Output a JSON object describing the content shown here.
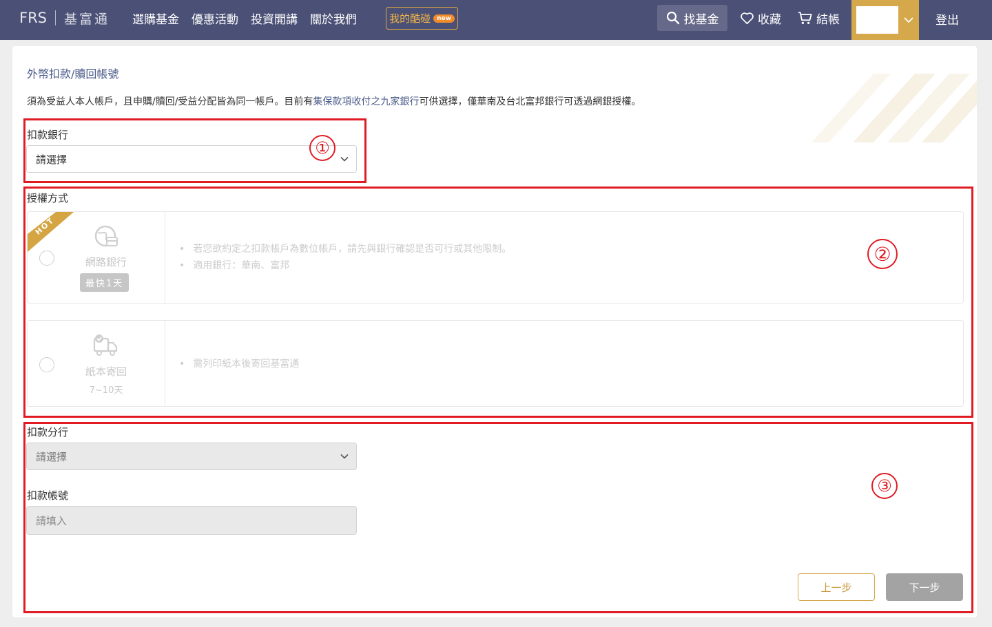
{
  "header": {
    "logo_text": "FRS",
    "company_name": "基富通",
    "nav": [
      "選購基金",
      "優惠活動",
      "投資開講",
      "關於我們"
    ],
    "my_coupon": "我的酷碰",
    "new_badge": "new",
    "find_fund": "找基金",
    "favorite": "收藏",
    "checkout": "結帳",
    "logout": "登出"
  },
  "page": {
    "section_title": "外幣扣款/贖回帳號",
    "notice_before": "須為受益人本人帳戶，且申購/贖回/受益分配皆為同一帳戶。目前有",
    "notice_link": "集保款項收付之九家銀行",
    "notice_after": "可供選擇，僅華南及台北富邦銀行可透過網銀授權。"
  },
  "bank": {
    "label": "扣款銀行",
    "value": "請選擇"
  },
  "auth": {
    "label": "授權方式",
    "options": [
      {
        "hot": "HOT",
        "name": "網路銀行",
        "speed": "最快1天",
        "bullets": [
          "若您欲約定之扣款帳戶為數位帳戶，請先與銀行確認是否可行或其他限制。",
          "適用銀行：華南、富邦"
        ]
      },
      {
        "name": "紙本寄回",
        "speed": "7~10天",
        "bullets": [
          "需列印紙本後寄回基富通"
        ]
      }
    ]
  },
  "branch": {
    "label": "扣款分行",
    "value": "請選擇"
  },
  "account": {
    "label": "扣款帳號",
    "placeholder": "請填入"
  },
  "buttons": {
    "prev": "上一步",
    "next": "下一步"
  },
  "annotations": [
    "①",
    "②",
    "③"
  ],
  "colors": {
    "header_bg": "#4b5076",
    "gold": "#d6a84c",
    "annotation_red": "#e01b24",
    "title_blue": "#4a5a8a"
  }
}
